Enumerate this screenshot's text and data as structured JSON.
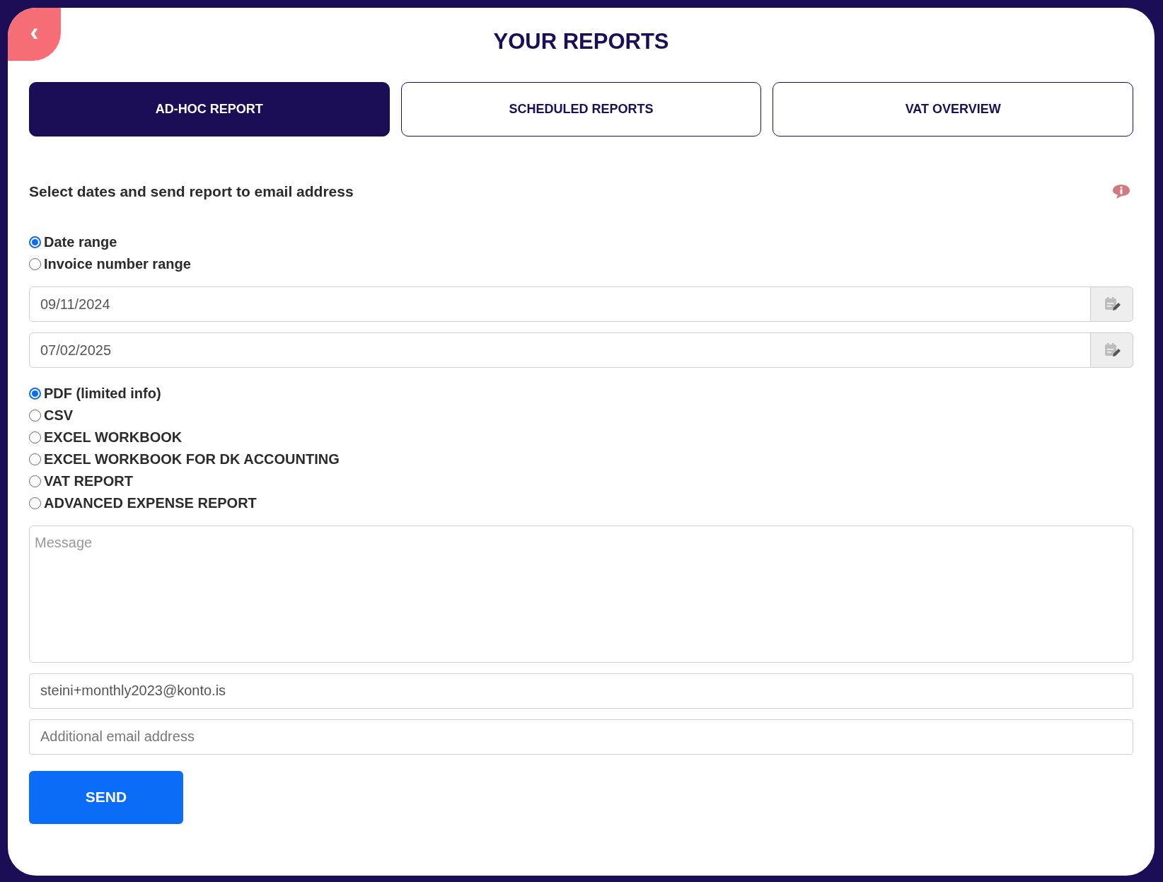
{
  "back_button": {
    "label": "‹"
  },
  "title": "YOUR REPORTS",
  "tabs": [
    {
      "label": "AD-HOC REPORT",
      "selected": true
    },
    {
      "label": "SCHEDULED REPORTS",
      "selected": false
    },
    {
      "label": "VAT OVERVIEW",
      "selected": false
    }
  ],
  "heading": "Select dates and send report to email address",
  "range_options": [
    {
      "label": "Date range",
      "selected": true
    },
    {
      "label": "Invoice number range",
      "selected": false
    }
  ],
  "date_fields": [
    {
      "value": "09/11/2024"
    },
    {
      "value": "07/02/2025"
    }
  ],
  "format_options": [
    {
      "label": "PDF (limited info)",
      "selected": true
    },
    {
      "label": "CSV",
      "selected": false
    },
    {
      "label": "EXCEL WORKBOOK",
      "selected": false
    },
    {
      "label": "EXCEL WORKBOOK FOR DK ACCOUNTING",
      "selected": false
    },
    {
      "label": "VAT REPORT",
      "selected": false
    },
    {
      "label": "ADVANCED EXPENSE REPORT",
      "selected": false
    }
  ],
  "message": {
    "placeholder": "Message"
  },
  "email": {
    "value": "steini+monthly2023@konto.is"
  },
  "additional_email": {
    "placeholder": "Additional email address"
  },
  "send_button": {
    "label": "SEND"
  }
}
